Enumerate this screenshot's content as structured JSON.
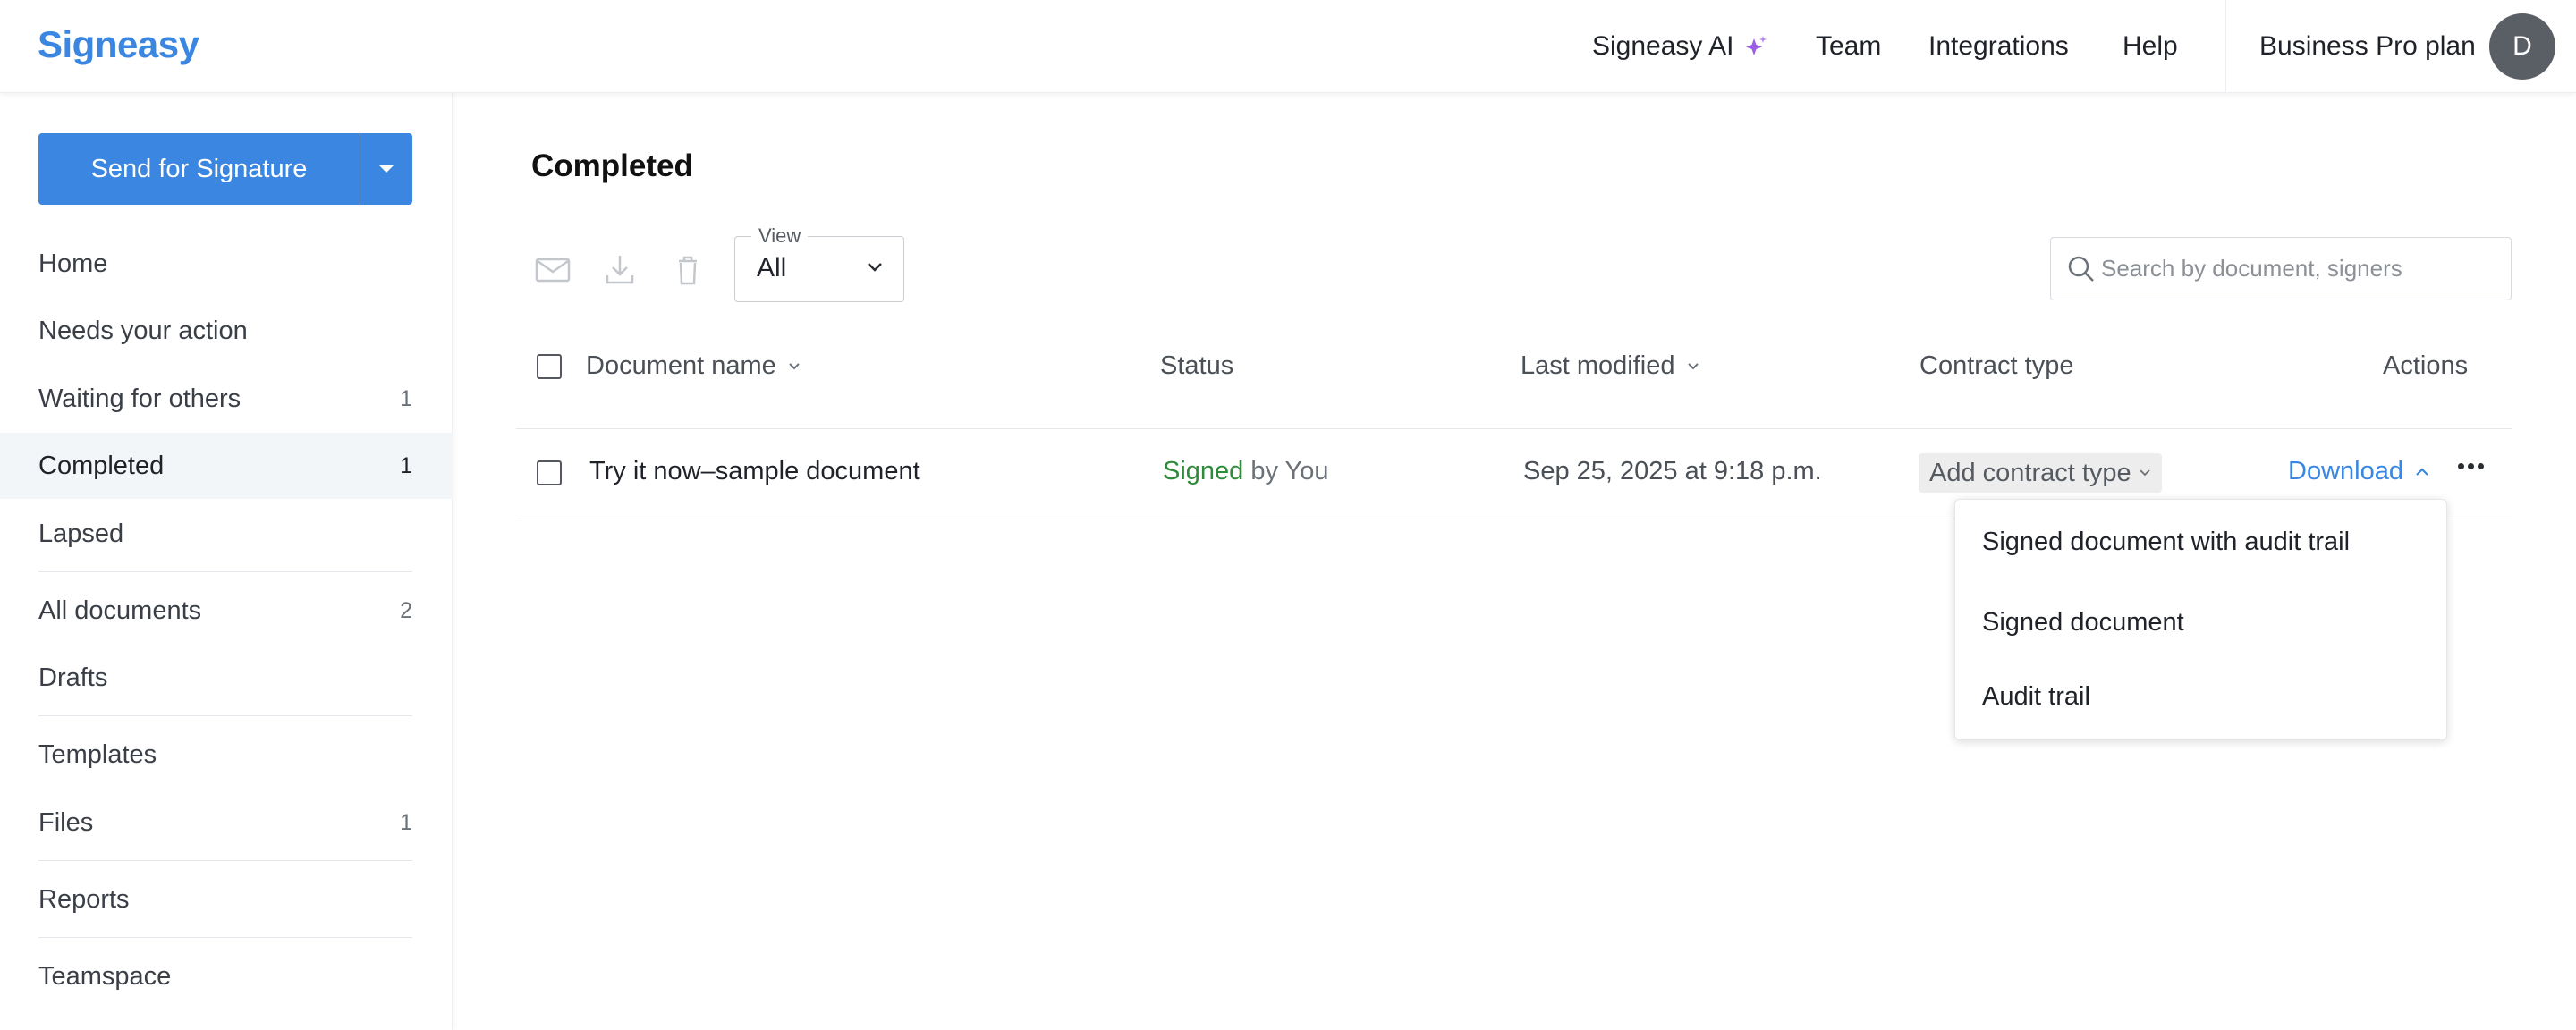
{
  "header": {
    "logo": "Signeasy",
    "nav": [
      "Signeasy AI",
      "Team",
      "Integrations",
      "Help"
    ],
    "plan": "Business Pro plan",
    "avatar_initial": "D",
    "accent": "#3a86e0",
    "ai_spark_color": "#9b5de5"
  },
  "sidebar": {
    "send_button": "Send for Signature",
    "items": [
      {
        "label": "Home",
        "count": ""
      },
      {
        "label": "Needs your action",
        "count": ""
      },
      {
        "label": "Waiting for others",
        "count": "1"
      },
      {
        "label": "Completed",
        "count": "1"
      },
      {
        "label": "Lapsed",
        "count": ""
      },
      {
        "label": "All documents",
        "count": "2"
      },
      {
        "label": "Drafts",
        "count": ""
      },
      {
        "label": "Templates",
        "count": ""
      },
      {
        "label": "Files",
        "count": "1"
      },
      {
        "label": "Reports",
        "count": ""
      },
      {
        "label": "Teamspace",
        "count": ""
      }
    ],
    "active_item": "Completed"
  },
  "main": {
    "title": "Completed",
    "toolbar_icons": [
      "mail-icon",
      "download-icon",
      "trash-icon"
    ],
    "view": {
      "legend": "View",
      "value": "All"
    },
    "search": {
      "placeholder": "Search by document, signers"
    },
    "columns": [
      "Document name",
      "Status",
      "Last modified",
      "Contract type",
      "Actions"
    ],
    "rows": [
      {
        "name": "Try it now–sample document",
        "status_word": "Signed",
        "status_by": " by You",
        "modified": "Sep 25, 2025 at 9:18 p.m.",
        "contract_type": "Add contract type",
        "action": "Download"
      }
    ],
    "download_menu": [
      "Signed document with audit trail",
      "Signed document",
      "Audit trail"
    ]
  }
}
